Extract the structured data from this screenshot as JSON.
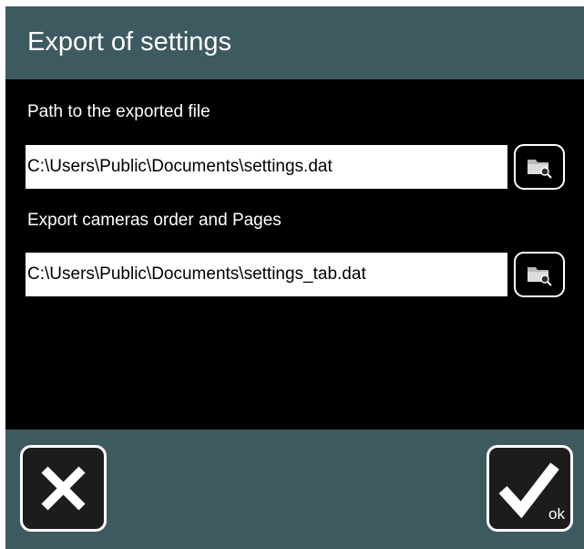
{
  "dialog": {
    "title": "Export of settings"
  },
  "fields": [
    {
      "label": "Path to the exported file",
      "value": "C:\\Users\\Public\\Documents\\settings.dat",
      "browse_icon": "folder-search-icon"
    },
    {
      "label": "Export cameras order and Pages",
      "value": "C:\\Users\\Public\\Documents\\settings_tab.dat",
      "browse_icon": "folder-search-icon"
    }
  ],
  "footer": {
    "cancel_icon": "close-icon",
    "ok_icon": "checkmark-icon",
    "ok_label": "ok"
  },
  "colors": {
    "header_footer": "#3e5a61",
    "content_background": "#000000",
    "text": "#ffffff"
  }
}
